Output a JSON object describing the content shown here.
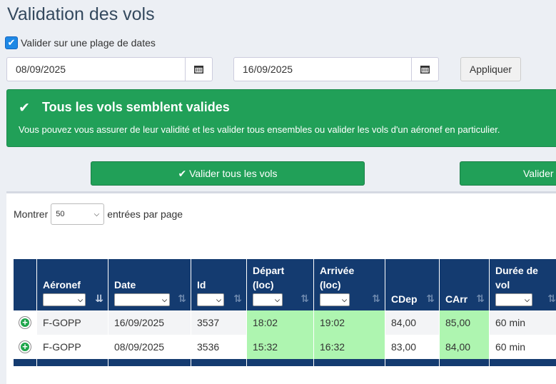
{
  "page": {
    "title": "Validation des vols"
  },
  "range": {
    "checked": true,
    "label": "Valider sur une plage de dates"
  },
  "dates": {
    "from": "08/09/2025",
    "to": "16/09/2025",
    "apply_label": "Appliquer"
  },
  "alert": {
    "title": "Tous les vols semblent valides",
    "text": "Vous pouvez vous assurer de leur validité et les valider tous ensembles ou valider les vols d'un aéronef en particulier."
  },
  "actions": {
    "validate_all": "✔ Valider tous les vols",
    "validate_aircraft": "Valider"
  },
  "table_controls": {
    "show_prefix": "Montrer",
    "page_size": "50",
    "show_suffix": "entrées par page"
  },
  "table": {
    "headers": [
      "Aéronef",
      "Date",
      "Id",
      "Départ (loc)",
      "Arrivée (loc)",
      "CDep",
      "CArr",
      "Durée de vol"
    ],
    "rows": [
      [
        "F-GOPP",
        "16/09/2025",
        "3537",
        "18:02",
        "19:02",
        "84,00",
        "85,00",
        "60 min"
      ],
      [
        "F-GOPP",
        "08/09/2025",
        "3536",
        "15:32",
        "16:32",
        "83,00",
        "84,00",
        "60 min"
      ]
    ]
  },
  "colors": {
    "accent_green": "#21a058",
    "header_navy": "#143b70",
    "highlight": "#aef5b0"
  }
}
